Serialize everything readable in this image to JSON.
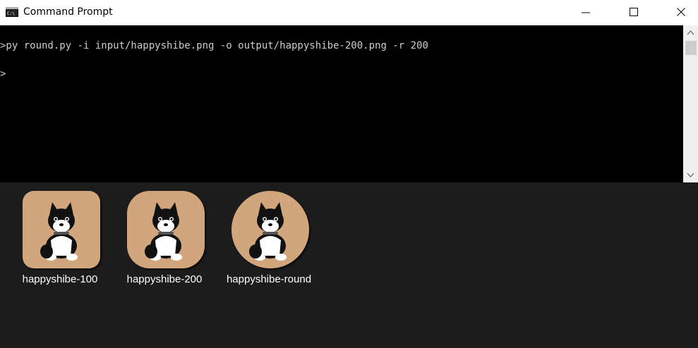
{
  "window": {
    "title": "Command Prompt",
    "icon": "cmd-icon",
    "controls": [
      "minimize-icon",
      "maximize-icon",
      "close-icon"
    ]
  },
  "terminal": {
    "lines": [
      ">py round.py -i input/happyshibe.png -o output/happyshibe-200.png -r 200",
      ">"
    ]
  },
  "files": [
    {
      "name": "happyshibe-100",
      "corner_radius_label": "100"
    },
    {
      "name": "happyshibe-200",
      "corner_radius_label": "200"
    },
    {
      "name": "happyshibe-round",
      "corner_radius_label": "round"
    }
  ],
  "colors": {
    "terminal_bg": "#000000",
    "terminal_text": "#cccccc",
    "thumb_bg": "#d2a67c",
    "explorer_bg": "#1c1c1c"
  }
}
